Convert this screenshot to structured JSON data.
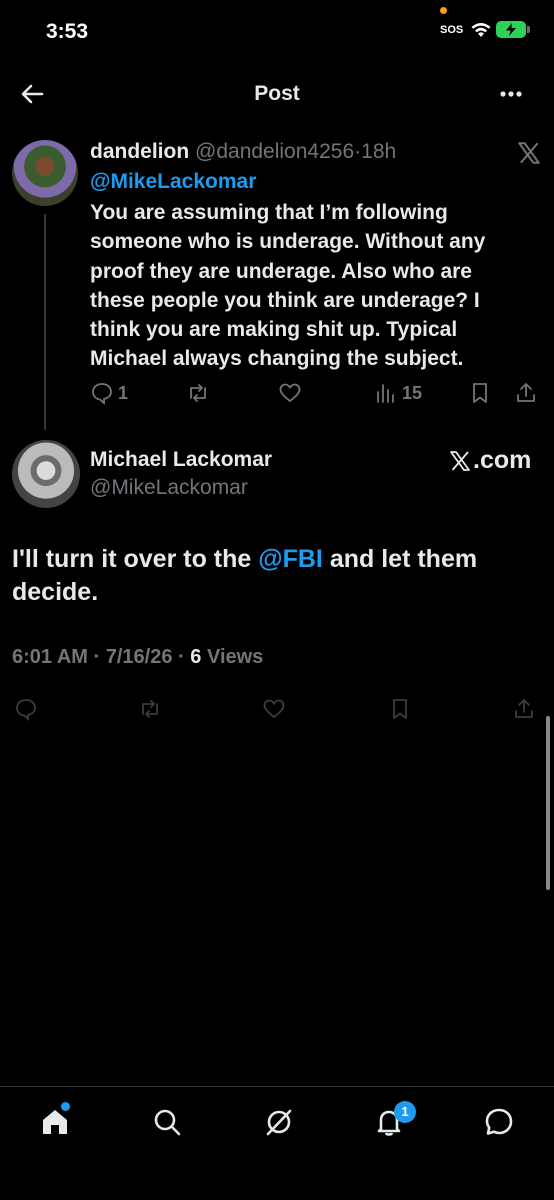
{
  "status_bar": {
    "time": "3:53",
    "sos": "SOS",
    "battery_color": "#30d158"
  },
  "header": {
    "title": "Post",
    "back_icon": "arrow-left-icon",
    "more_icon": "more-horizontal-icon"
  },
  "reply_tweet": {
    "display_name": "dandelion",
    "handle": "@dandelion4256",
    "separator": "·",
    "time_ago": "18h",
    "mention": "@MikeLackomar",
    "text": "You are assuming that I’m following someone who is underage. Without any proof they are underage. Also who are these people you think are underage? I think you are making shit up. Typical Michael always changing the subject.",
    "replies": "1",
    "views": "15",
    "source_icon": "x-logo-icon"
  },
  "main_tweet": {
    "display_name": "Michael Lackomar",
    "handle": "@MikeLackomar",
    "source_label": ".com",
    "text_before": "I'll turn it over to the ",
    "text_link": "@FBI",
    "text_after": " and let them decide.",
    "time": "6:01 AM",
    "date": "7/16/26",
    "views_count": "6",
    "views_label": "Views",
    "separator": "·"
  },
  "tab_bar": {
    "items": [
      "home-icon",
      "search-icon",
      "grok-icon",
      "notifications-icon",
      "messages-icon"
    ],
    "notifications_badge": "1",
    "accent": "#1d9bf0"
  },
  "colors": {
    "background": "#000000",
    "text": "#e7e9ea",
    "muted": "#71767b",
    "link": "#1d9bf0"
  }
}
